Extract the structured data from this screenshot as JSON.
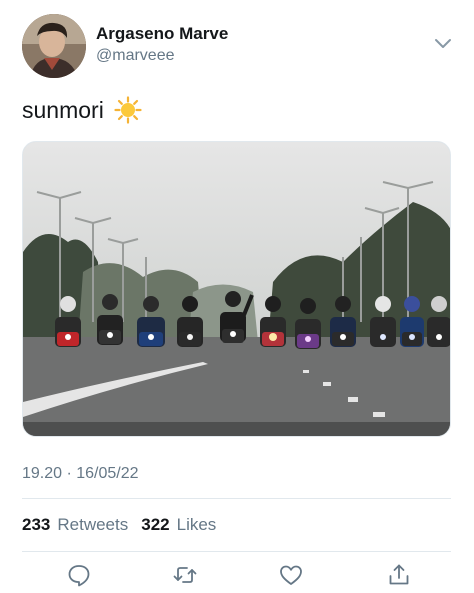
{
  "author": {
    "display_name": "Argaseno Marve",
    "handle": "@marveee"
  },
  "tweet": {
    "text": "sunmori",
    "emoji": "☀️",
    "timestamp": "19.20 · 16/05/22"
  },
  "stats": {
    "retweets_count": "233",
    "retweets_label": "Retweets",
    "likes_count": "322",
    "likes_label": "Likes"
  },
  "actions": [
    "reply-icon",
    "retweet-icon",
    "like-icon",
    "share-icon"
  ],
  "colors": {
    "text_primary": "#14171a",
    "text_secondary": "#657786",
    "divider": "#e1e8ed"
  }
}
